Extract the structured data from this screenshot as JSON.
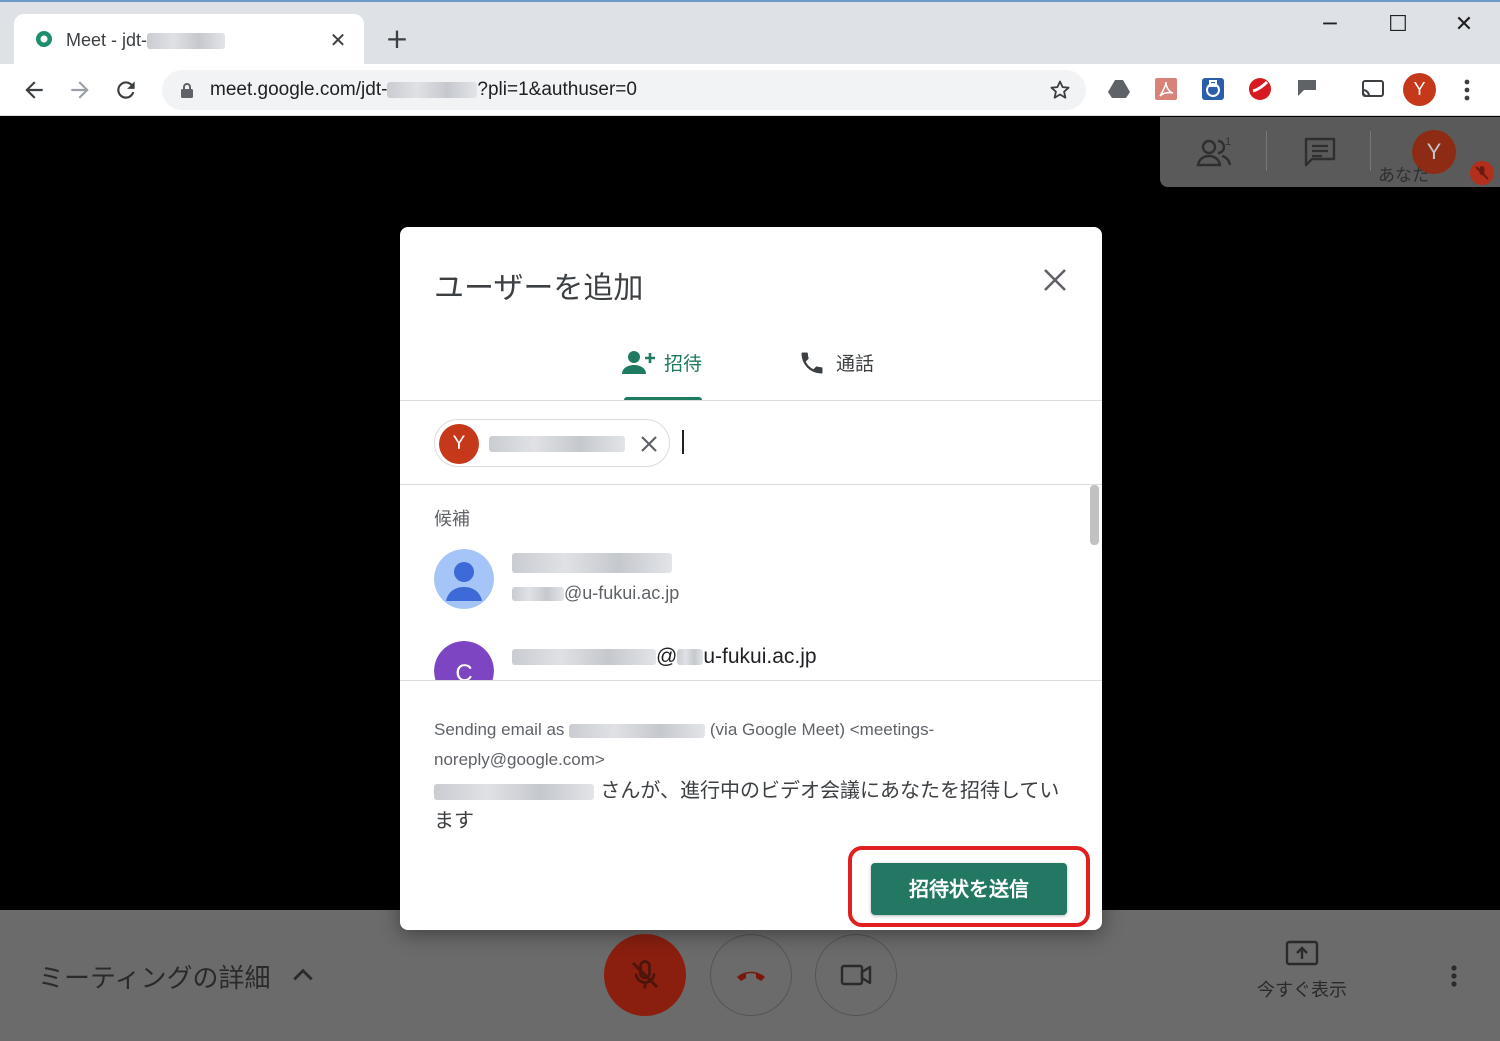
{
  "browser": {
    "tab_title": "Meet - jdt-",
    "tab_close": "✕",
    "new_tab": "+",
    "url": "meet.google.com/jdt-",
    "url_suffix": "?pli=1&authuser=0",
    "profile_initial": "Y",
    "window_controls": {
      "minimize": "─",
      "maximize": "☐",
      "close": "✕"
    }
  },
  "meet": {
    "top_panel": {
      "self_initial": "Y",
      "self_label": "あなた",
      "participants_count": "1"
    },
    "bottom_bar": {
      "meeting_details": "ミーティングの詳細",
      "present_label": "今すぐ表示"
    }
  },
  "dialog": {
    "title": "ユーザーを追加",
    "tabs": [
      {
        "label": "招待"
      },
      {
        "label": "通話"
      }
    ],
    "chip": {
      "initial": "Y"
    },
    "suggestions_header": "候補",
    "suggestions": [
      {
        "email_domain": "@u-fukui.ac.jp"
      },
      {
        "initial": "C",
        "email": "u-fukui.ac.jp"
      }
    ],
    "message": {
      "sender_prefix": "Sending email as",
      "sender_suffix": "(via Google Meet) <meetings-noreply@google.com>",
      "body": "さんが、進行中のビデオ会議にあなたを招待しています"
    },
    "send_button": "招待状を送信"
  },
  "colors": {
    "accent_green": "#227863",
    "avatar_red": "#c5381a",
    "highlight_red": "#e0201f"
  }
}
